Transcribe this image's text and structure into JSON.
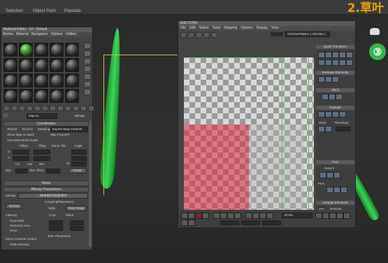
{
  "topbar": {
    "selection": "Selection",
    "object_paint": "Object Paint",
    "populate": "Populate"
  },
  "chapter": "2.草叶",
  "badge": "③",
  "material_editor": {
    "title": "Material Editor - 02 - Default",
    "menu": [
      "Modes",
      "Material",
      "Navigation",
      "Options",
      "Utilities"
    ],
    "map_name": "Map #1",
    "map_type": "Bitmap",
    "coordinates_header": "Coordinates",
    "texture_label": "Texture",
    "environ_label": "Environ",
    "mapping_label": "Mapping:",
    "mapping_value": "Explicit Map Channel",
    "map_channel_label": "Map Channel:",
    "show_map_label": "Show Map on Back",
    "realworld_label": "Use Real-World Scale",
    "offset": "Offset",
    "tiling": "Tiling",
    "mirror_tile": "Mirror Tile",
    "angle": "Angle",
    "u": "U:",
    "v": "V:",
    "w": "W:",
    "uv": "UV",
    "vw": "VW",
    "wu": "WU",
    "blur": "Blur:",
    "blur_offset": "Blur offset:",
    "rotate": "Rotate",
    "noise_header": "Noise",
    "bitmap_params_header": "Bitmap Parameters",
    "bitmap_label": "Bitmap:",
    "bitmap_path": "…\\样本制作\\贴图\\草叶...",
    "reload": "Reload",
    "cropping": "Cropping/Placement",
    "apply": "Apply",
    "view_image": "View Image",
    "filtering": "Filtering",
    "pyramidal": "Pyramidal",
    "summed_area": "Summed Area",
    "none": "None",
    "crop": "Crop",
    "place": "Place",
    "mono_output": "Mono Channel Output:",
    "rgb_intensity": "RGB Intensity",
    "jitter": "Jitter Placement:"
  },
  "uv_editor": {
    "title": "Edit UVWs",
    "menu": [
      "File",
      "Edit",
      "Select",
      "Tools",
      "Mapping",
      "Options",
      "Display",
      "View"
    ],
    "pattern_dropdown": "CheckerPattern ( Checker )",
    "quick_transform": "Quick Transform",
    "reshape_elements": "Reshape Elements",
    "stitch": "Stitch",
    "explode": "Explode",
    "weld": "Weld",
    "threshold_label": "Threshold:",
    "peel": "Peel",
    "detach": "Detach",
    "pins": "Pins:",
    "arrange_elements": "Arrange Elements",
    "rescale": "Rescale",
    "rotate": "Rotate",
    "padding": "Padding:",
    "all_ids": "All IDs"
  }
}
